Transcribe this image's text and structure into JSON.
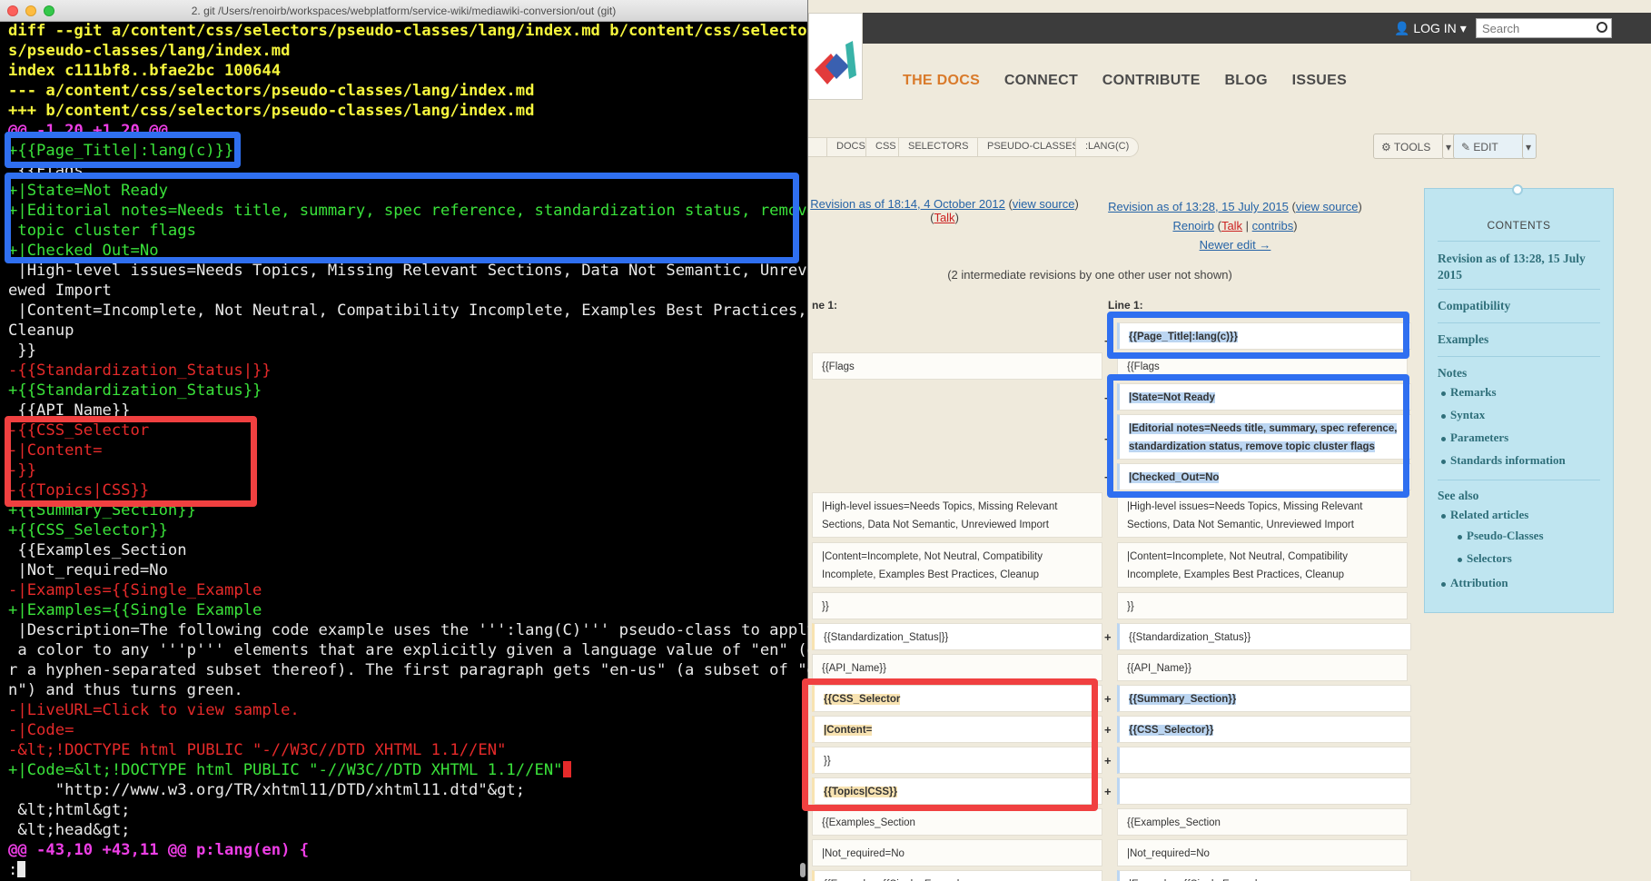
{
  "terminal": {
    "title": "2. git  /Users/renoirb/workspaces/webplatform/service-wiki/mediawiki-conversion/out (git)",
    "lines": [
      {
        "c": "c-y",
        "t": "diff --git a/content/css/selectors/pseudo-classes/lang/index.md b/content/css/selector"
      },
      {
        "c": "c-y",
        "t": "s/pseudo-classes/lang/index.md"
      },
      {
        "c": "c-y",
        "t": "index c111bf8..bfae2bc 100644"
      },
      {
        "c": "c-y",
        "t": "--- a/content/css/selectors/pseudo-classes/lang/index.md"
      },
      {
        "c": "c-y",
        "t": "+++ b/content/css/selectors/pseudo-classes/lang/index.md"
      },
      {
        "c": "c-m",
        "t": "@@ -1,20 +1,20 @@"
      },
      {
        "c": "c-g",
        "t": "+{{Page_Title|:lang(c)}}"
      },
      {
        "c": "c-w",
        "t": " {{Flags"
      },
      {
        "c": "c-g",
        "t": "+|State=Not Ready"
      },
      {
        "c": "c-g",
        "t": "+|Editorial notes=Needs title, summary, spec reference, standardization status, remove"
      },
      {
        "c": "c-g",
        "t": " topic cluster flags"
      },
      {
        "c": "c-g",
        "t": "+|Checked_Out=No"
      },
      {
        "c": "c-w",
        "t": " |High-level issues=Needs Topics, Missing Relevant Sections, Data Not Semantic, Unrevi"
      },
      {
        "c": "c-w",
        "t": "ewed Import"
      },
      {
        "c": "c-w",
        "t": " |Content=Incomplete, Not Neutral, Compatibility Incomplete, Examples Best Practices,"
      },
      {
        "c": "c-w",
        "t": "Cleanup"
      },
      {
        "c": "c-w",
        "t": " }}"
      },
      {
        "c": "c-r",
        "t": "-{{Standardization_Status|}}"
      },
      {
        "c": "c-g",
        "t": "+{{Standardization_Status}}"
      },
      {
        "c": "c-w",
        "t": " {{API_Name}}"
      },
      {
        "c": "c-r",
        "t": "-{{CSS_Selector"
      },
      {
        "c": "c-r",
        "t": "-|Content="
      },
      {
        "c": "c-r",
        "t": "-}}"
      },
      {
        "c": "c-r",
        "t": "-{{Topics|CSS}}"
      },
      {
        "c": "c-g",
        "t": "+{{Summary_Section}}"
      },
      {
        "c": "c-g",
        "t": "+{{CSS_Selector}}"
      },
      {
        "c": "c-w",
        "t": " {{Examples_Section"
      },
      {
        "c": "c-w",
        "t": " |Not_required=No"
      },
      {
        "c": "c-r",
        "t": "-|Examples={{Single_Example"
      },
      {
        "c": "c-g",
        "t": "+|Examples={{Single Example"
      },
      {
        "c": "c-w",
        "t": " |Description=The following code example uses the ''':lang(C)''' pseudo-class to apply"
      },
      {
        "c": "c-w",
        "t": " a color to any '''p''' elements that are explicitly given a language value of \"en\" (o"
      },
      {
        "c": "c-w",
        "t": "r a hyphen-separated subset thereof). The first paragraph gets \"en-us\" (a subset of \"e"
      },
      {
        "c": "c-w",
        "t": "n\") and thus turns green."
      },
      {
        "c": "c-r",
        "t": "-|LiveURL=Click to view sample."
      },
      {
        "c": "c-r",
        "t": "-|Code="
      },
      {
        "c": "c-r",
        "t": "-&lt;!DOCTYPE html PUBLIC \"-//W3C//DTD XHTML 1.1//EN\""
      },
      {
        "c": "c-g",
        "t": "+|Code=&lt;!DOCTYPE html PUBLIC \"-//W3C//DTD XHTML 1.1//EN\""
      },
      {
        "c": "c-w",
        "t": "     \"http://www.w3.org/TR/xhtml11/DTD/xhtml11.dtd\"&gt;"
      },
      {
        "c": "c-w",
        "t": " &lt;html&gt;"
      },
      {
        "c": "c-w",
        "t": " &lt;head&gt;"
      },
      {
        "c": "c-m",
        "t": "@@ -43,10 +43,11 @@ p:lang(en) {"
      },
      {
        "c": "c-w",
        "t": ":"
      }
    ]
  },
  "wiki": {
    "login": "LOG IN",
    "search_placeholder": "Search",
    "nav": [
      "THE DOCS",
      "CONNECT",
      "CONTRIBUTE",
      "BLOG",
      "ISSUES"
    ],
    "breadcrumbs": [
      "DOCS",
      "CSS",
      "SELECTORS",
      "PSEUDO-CLASSES",
      ":LANG(C)"
    ],
    "tools": "TOOLS",
    "edit": "EDIT",
    "left_rev": {
      "title": "Revision as of 18:14, 4 October 2012",
      "view": "view source",
      "talk": "Talk"
    },
    "right_rev": {
      "title": "Revision as of 13:28, 15 July 2015",
      "view": "view source",
      "user": "Renoirb",
      "talk": "Talk",
      "contribs": "contribs",
      "newer": "Newer edit →"
    },
    "intermediate": "(2 intermediate revisions by one other user not shown)",
    "line_left": "ne 1:",
    "line_right": "Line 1:",
    "left_rows": [
      "{{Flags",
      "|High-level issues=Needs Topics, Missing Relevant Sections, Data Not Semantic, Unreviewed Import",
      "|Content=Incomplete, Not Neutral, Compatibility Incomplete, Examples Best Practices, Cleanup",
      "}}",
      "{{Standardization_Status|}}",
      "{{API_Name}}",
      "{{CSS_Selector",
      "|Content=",
      "}}",
      "{{Topics|CSS}}",
      "{{Examples_Section",
      "|Not_required=No",
      "{{Examples={{Single_Example"
    ],
    "right_rows": [
      "{{Page_Title|:lang(c)}}",
      "{{Flags",
      "|State=Not Ready",
      "|Editorial notes=Needs title, summary, spec reference, standardization status, remove topic cluster flags",
      "|Checked_Out=No",
      "|High-level issues=Needs Topics, Missing Relevant Sections, Data Not Semantic, Unreviewed Import",
      "|Content=Incomplete, Not Neutral, Compatibility Incomplete, Examples Best Practices, Cleanup",
      "}}",
      "{{Standardization_Status}}",
      "{{API_Name}}",
      "{{Summary_Section}}",
      "{{CSS_Selector}}",
      "{{Examples_Section",
      "|Not_required=No",
      "|Examples={{Single Example"
    ],
    "toc": {
      "title": "CONTENTS",
      "items": [
        "Revision as of 13:28, 15 July 2015",
        "Compatibility",
        "Examples",
        "Notes",
        "Remarks",
        "Syntax",
        "Parameters",
        "Standards information",
        "See also",
        "Related articles",
        "Pseudo-Classes",
        "Selectors",
        "Attribution"
      ]
    }
  }
}
